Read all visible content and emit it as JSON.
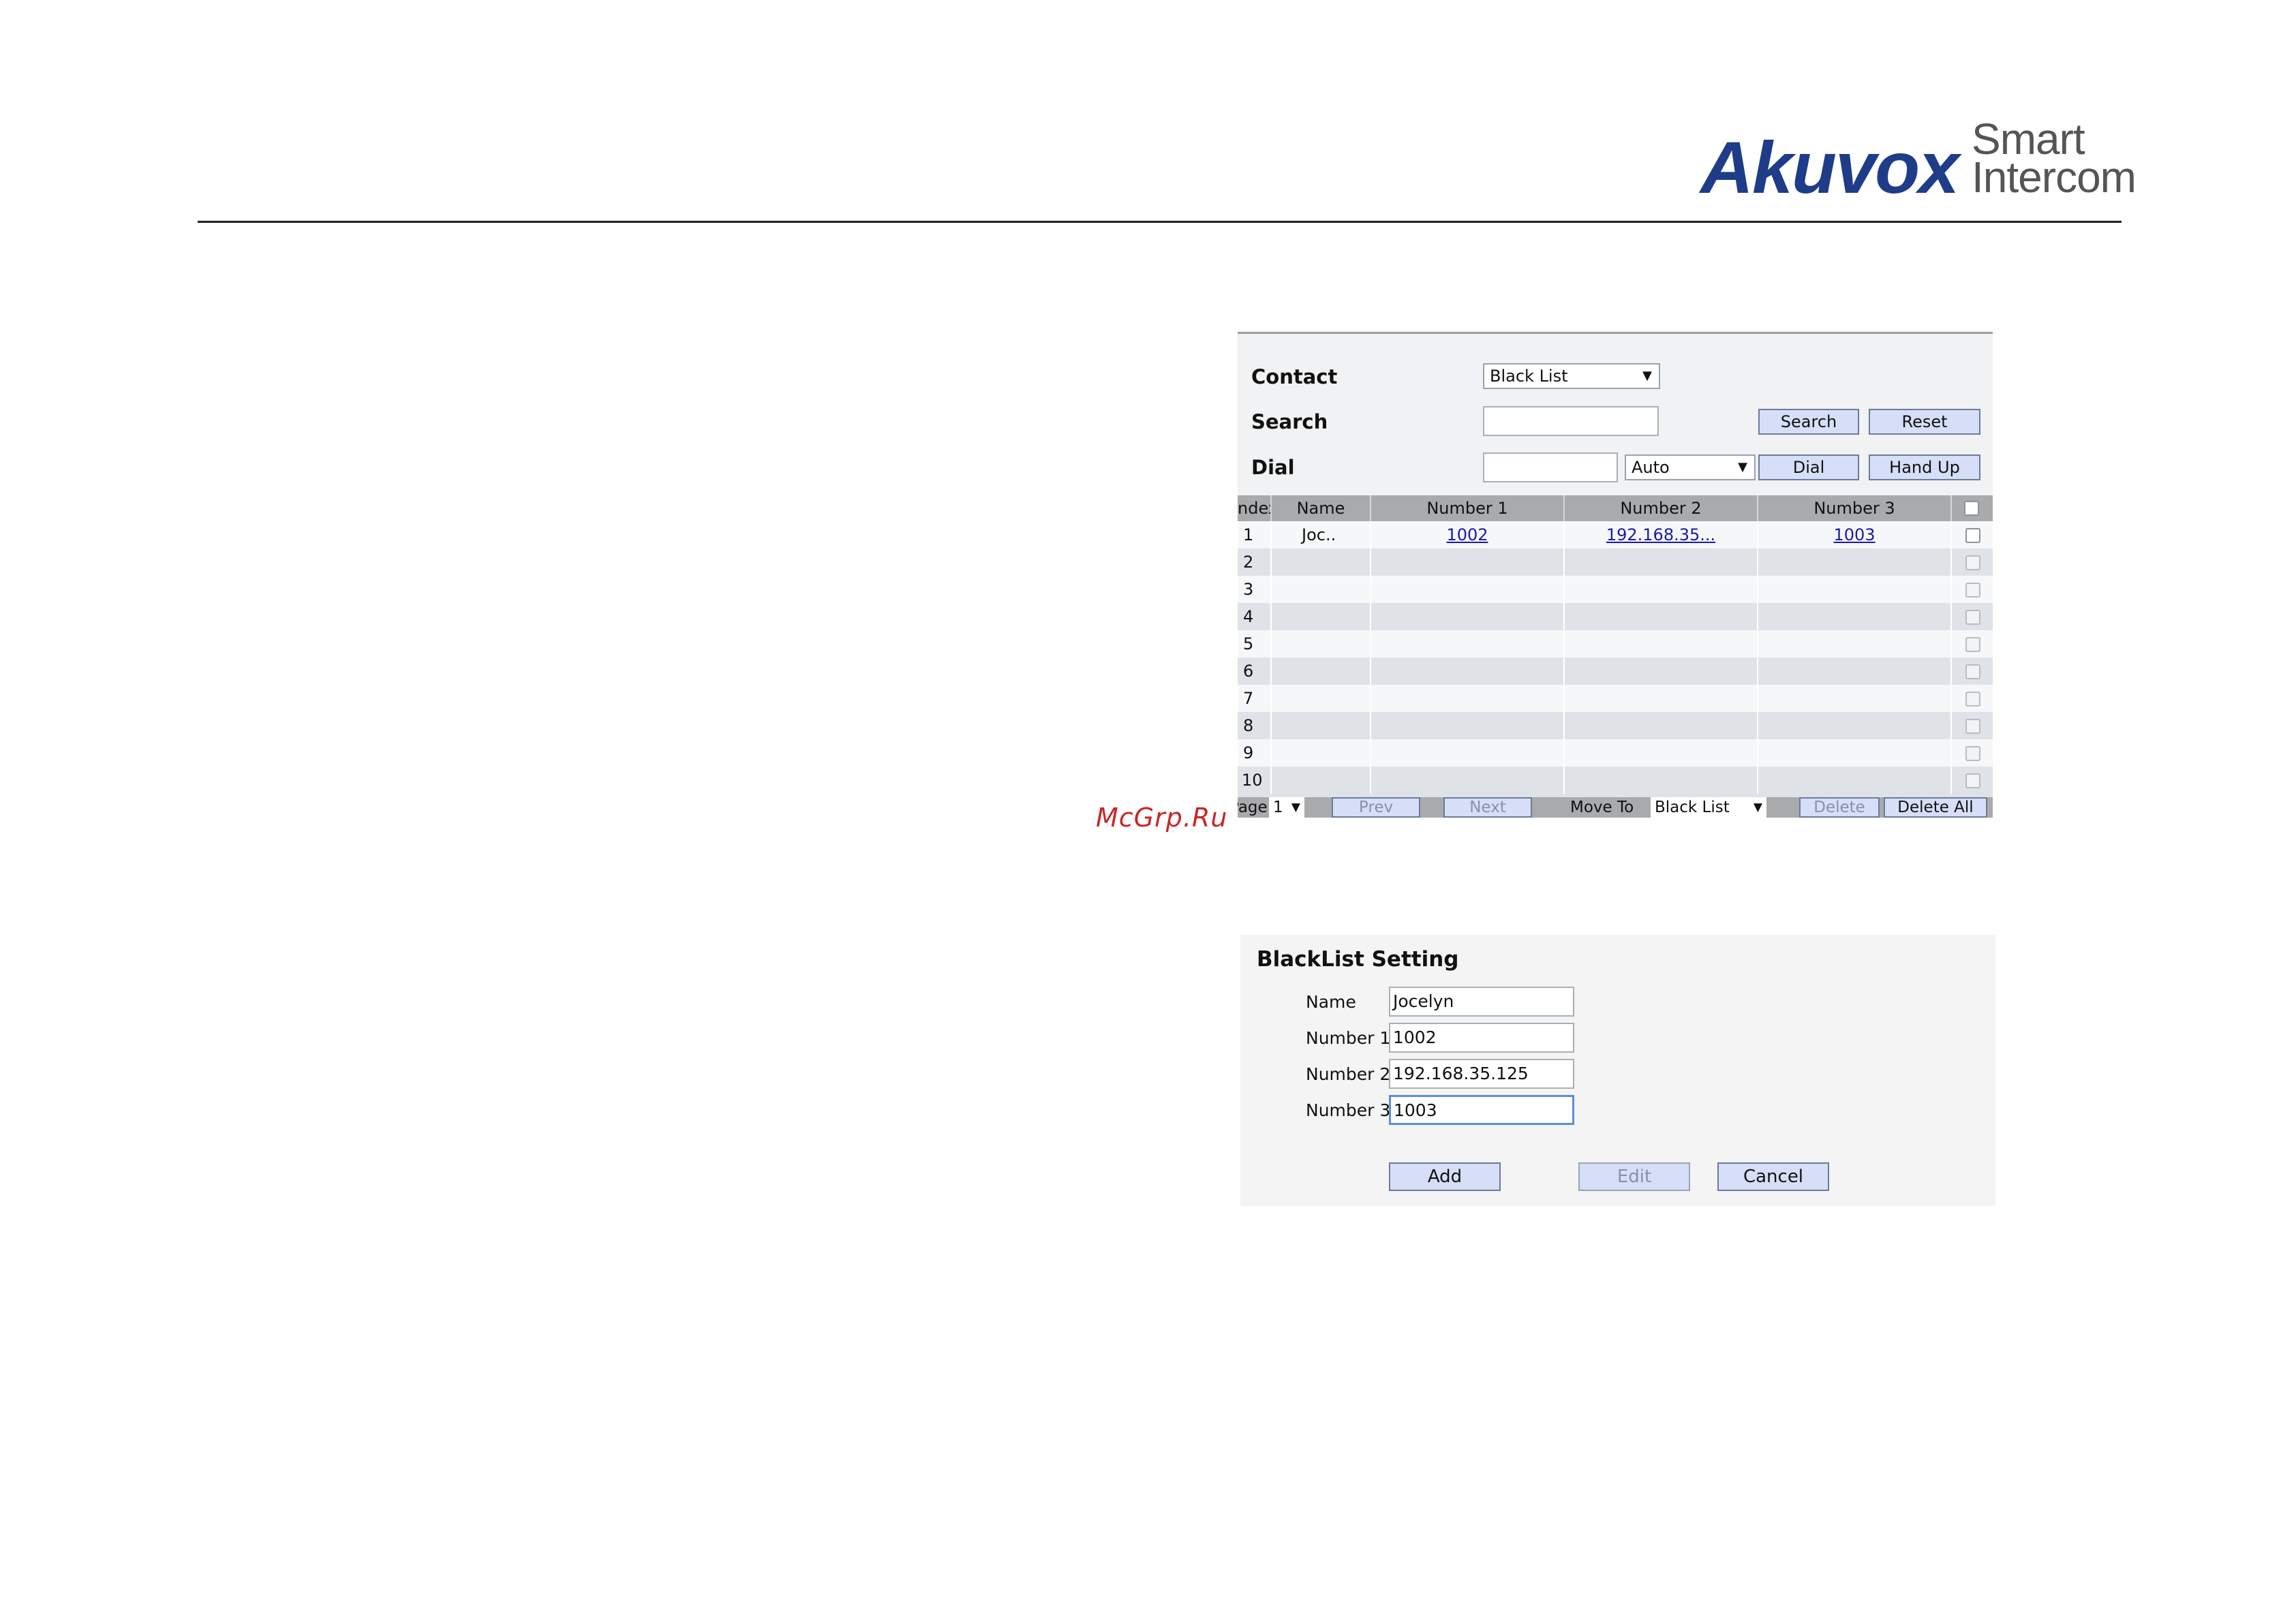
{
  "logo": {
    "brand": "Akuvox",
    "line1": "Smart",
    "line2": "Intercom",
    "brand_color": "#1f3c88"
  },
  "watermark": "McGrp.Ru",
  "contact_panel": {
    "contact_label": "Contact",
    "contact_select": "Black List",
    "search_label": "Search",
    "search_value": "",
    "search_button": "Search",
    "reset_button": "Reset",
    "dial_label": "Dial",
    "dial_value": "",
    "dial_mode": "Auto",
    "dial_button": "Dial",
    "hangup_button": "Hand Up",
    "table": {
      "headers": {
        "index": "ndex",
        "name": "Name",
        "number1": "Number 1",
        "number2": "Number 2",
        "number3": "Number 3"
      },
      "rows": [
        {
          "index": "1",
          "name": "Joc..",
          "number1": "1002",
          "number2": "192.168.35...",
          "number3": "1003"
        },
        {
          "index": "2",
          "name": "",
          "number1": "",
          "number2": "",
          "number3": ""
        },
        {
          "index": "3",
          "name": "",
          "number1": "",
          "number2": "",
          "number3": ""
        },
        {
          "index": "4",
          "name": "",
          "number1": "",
          "number2": "",
          "number3": ""
        },
        {
          "index": "5",
          "name": "",
          "number1": "",
          "number2": "",
          "number3": ""
        },
        {
          "index": "6",
          "name": "",
          "number1": "",
          "number2": "",
          "number3": ""
        },
        {
          "index": "7",
          "name": "",
          "number1": "",
          "number2": "",
          "number3": ""
        },
        {
          "index": "8",
          "name": "",
          "number1": "",
          "number2": "",
          "number3": ""
        },
        {
          "index": "9",
          "name": "",
          "number1": "",
          "number2": "",
          "number3": ""
        },
        {
          "index": "10",
          "name": "",
          "number1": "",
          "number2": "",
          "number3": ""
        }
      ]
    },
    "pager": {
      "page_label": "Page",
      "page_value": "1",
      "prev": "Prev",
      "next": "Next",
      "move_to_label": "Move To",
      "move_to_value": "Black List",
      "delete": "Delete",
      "delete_all": "Delete All"
    }
  },
  "blacklist_setting": {
    "title": "BlackList Setting",
    "name_label": "Name",
    "name_value": "Jocelyn",
    "number1_label": "Number 1",
    "number1_value": "1002",
    "number2_label": "Number 2",
    "number2_value": "192.168.35.125",
    "number3_label": "Number 3",
    "number3_value": "1003",
    "add_button": "Add",
    "edit_button": "Edit",
    "cancel_button": "Cancel"
  }
}
